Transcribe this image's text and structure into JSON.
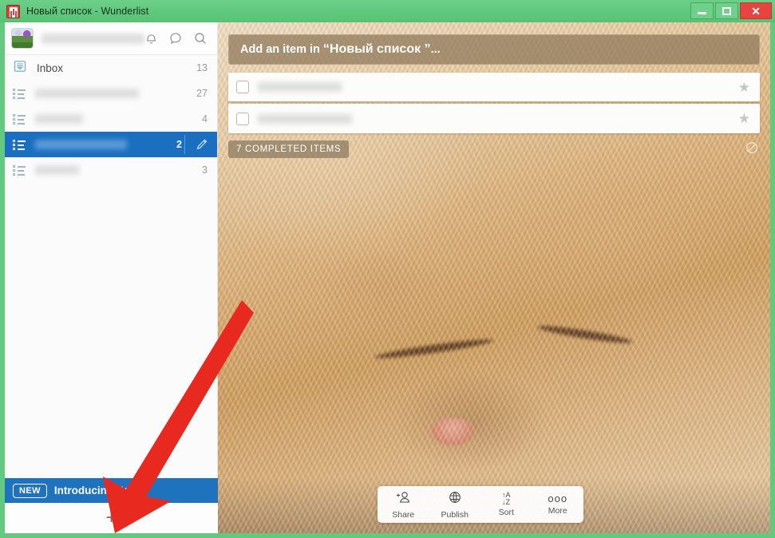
{
  "window": {
    "title": "Новый список - Wunderlist",
    "app_icon": "wunderlist-icon",
    "minimize_label": "–",
    "maximize_label": "□",
    "close_label": "✕",
    "frame_color": "#62c97e",
    "titlebar_color": "#62c97e",
    "close_color": "#e8443f"
  },
  "sidebar": {
    "avatar": "user-avatar",
    "username": "",
    "header_icons": [
      {
        "name": "notifications-bell-icon",
        "label": ""
      },
      {
        "name": "chat-bubble-icon",
        "label": ""
      },
      {
        "name": "search-icon",
        "label": ""
      }
    ],
    "items": [
      {
        "label": "Inbox",
        "count": "13",
        "icon": "inbox-icon",
        "selected": false,
        "blurred": false
      },
      {
        "label": "",
        "count": "27",
        "icon": "list-icon",
        "selected": false,
        "blurred": true
      },
      {
        "label": "",
        "count": "4",
        "icon": "list-icon",
        "selected": false,
        "blurred": true
      },
      {
        "label": "",
        "count": "2",
        "icon": "list-icon",
        "selected": true,
        "blurred": true
      },
      {
        "label": "",
        "count": "3",
        "icon": "list-icon",
        "selected": false,
        "blurred": true
      }
    ],
    "selected_accent": "#1b6fc0",
    "edit_icon": "pencil-icon",
    "banner": {
      "badge": "NEW",
      "text": "Introducing Fol",
      "color": "#1f72bd"
    },
    "add_list_label": "+"
  },
  "main": {
    "add_item": {
      "prefix": "Add an item in ",
      "list_name": "“Новый список ”",
      "suffix": "..."
    },
    "tasks": [
      {
        "title": "",
        "starred": false,
        "checked": false,
        "blurred": true
      },
      {
        "title": "",
        "starred": false,
        "checked": false,
        "blurred": true
      }
    ],
    "star_icon": "star-icon",
    "completed_badge": "7 COMPLETED ITEMS",
    "hide_completed_icon": "hide-circle-slash-icon",
    "background": "ginger-cat-photo",
    "toolbar": [
      {
        "label": "Share",
        "icon": "share-person-icon"
      },
      {
        "label": "Publish",
        "icon": "publish-globe-icon"
      },
      {
        "label": "Sort",
        "icon": "sort-az-icon",
        "glyph_top": "↑A",
        "glyph_bottom": "↓Z"
      },
      {
        "label": "More",
        "icon": "more-dots-icon",
        "glyph": "ooo"
      }
    ]
  },
  "annotation": {
    "arrow": "red-arrow-pointing-to-add-list-button",
    "color": "#e8291f"
  }
}
